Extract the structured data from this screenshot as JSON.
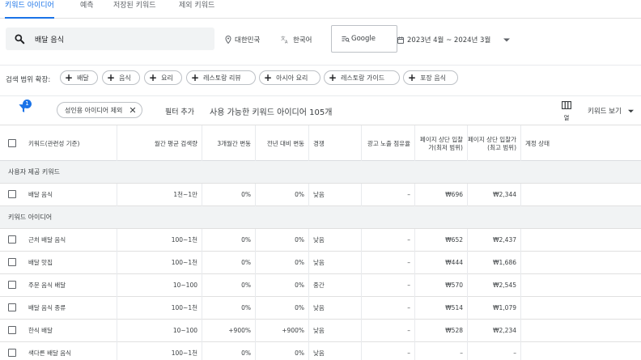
{
  "tabs": [
    "키워드 아이디어",
    "예측",
    "저장된 키워드",
    "제외 키워드"
  ],
  "search": {
    "value": "배달 음식"
  },
  "location": "대한민국",
  "language": "한국어",
  "network": "Google",
  "date_range": "2023년 4월 ~ 2024년 3월",
  "scope": {
    "label": "검색 범위 확장:",
    "chips": [
      "배달",
      "음식",
      "요리",
      "레스토랑 리뷰",
      "아시아 요리",
      "레스토랑 가이드",
      "포장 음식"
    ]
  },
  "filters": {
    "badge_count": "1",
    "active_filter": "성인용 아이디어 제외",
    "add_filter": "필터 추가",
    "available": "사용 가능한 키워드 아이디어 105개",
    "columns_label": "열",
    "view_label": "키워드 보기"
  },
  "table": {
    "headers": [
      "키워드(관련성 기준)",
      "월간 평균 검색량",
      "3개월간 변동",
      "전년 대비 변동",
      "경쟁",
      "광고 노출 점유율",
      "페이지 상단 입찰가(최저 범위)",
      "페이지 상단 입찰가(최고 범위)",
      "계정 상태"
    ],
    "section_provided": "사용자 제공 키워드",
    "section_ideas": "키워드 아이디어",
    "provided_rows": [
      {
        "keyword": "배달 음식",
        "volume": "1천~1만",
        "three_month": "0%",
        "yoy": "0%",
        "competition": "낮음",
        "impression_share": "–",
        "bid_low": "₩696",
        "bid_high": "₩2,344"
      }
    ],
    "idea_rows": [
      {
        "keyword": "근처 배달 음식",
        "volume": "100~1천",
        "three_month": "0%",
        "yoy": "0%",
        "competition": "낮음",
        "impression_share": "–",
        "bid_low": "₩652",
        "bid_high": "₩2,437"
      },
      {
        "keyword": "배달 맛집",
        "volume": "100~1천",
        "three_month": "0%",
        "yoy": "0%",
        "competition": "낮음",
        "impression_share": "–",
        "bid_low": "₩444",
        "bid_high": "₩1,686"
      },
      {
        "keyword": "주문 음식 배달",
        "volume": "10~100",
        "three_month": "0%",
        "yoy": "0%",
        "competition": "중간",
        "impression_share": "–",
        "bid_low": "₩570",
        "bid_high": "₩2,545"
      },
      {
        "keyword": "배달 음식 종류",
        "volume": "100~1천",
        "three_month": "0%",
        "yoy": "0%",
        "competition": "낮음",
        "impression_share": "–",
        "bid_low": "₩514",
        "bid_high": "₩1,079"
      },
      {
        "keyword": "한식 배달",
        "volume": "10~100",
        "three_month": "+900%",
        "yoy": "+900%",
        "competition": "낮음",
        "impression_share": "–",
        "bid_low": "₩528",
        "bid_high": "₩2,234"
      },
      {
        "keyword": "색다른 배달 음식",
        "volume": "100~1천",
        "three_month": "0%",
        "yoy": "0%",
        "competition": "낮음",
        "impression_share": "–",
        "bid_low": "–",
        "bid_high": "–"
      }
    ]
  },
  "colors": {
    "accent": "#1a73e8",
    "section_bg": "#f1f3f4",
    "border": "#e0e0e0"
  }
}
